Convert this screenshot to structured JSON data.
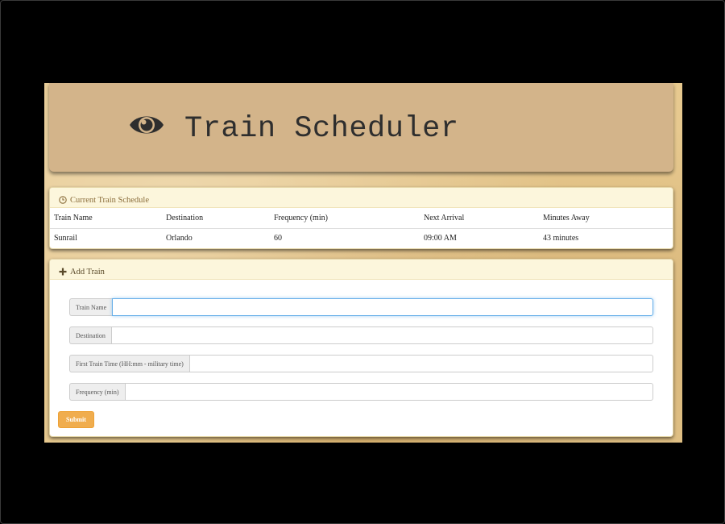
{
  "header": {
    "title": "Train Scheduler",
    "icon": "eye-icon"
  },
  "schedule": {
    "heading": "Current Train Schedule",
    "icon": "clock-icon",
    "columns": [
      "Train Name",
      "Destination",
      "Frequency (min)",
      "Next Arrival",
      "Minutes Away"
    ],
    "rows": [
      [
        "Sunrail",
        "Orlando",
        "60",
        "09:00 AM",
        "43 minutes"
      ]
    ]
  },
  "add_train": {
    "heading": "Add Train",
    "icon": "plus-icon",
    "fields": [
      {
        "label": "Train Name",
        "value": "",
        "focused": true
      },
      {
        "label": "Destination",
        "value": ""
      },
      {
        "label": "First Train Time (HH:mm - military time)",
        "value": ""
      },
      {
        "label": "Frequency (min)",
        "value": ""
      }
    ],
    "submit_label": "Submit"
  },
  "colors": {
    "header_bg": "#d3b48a",
    "panel_heading_text": "#8a6d3b",
    "submit_bg": "#f0ad4e"
  }
}
